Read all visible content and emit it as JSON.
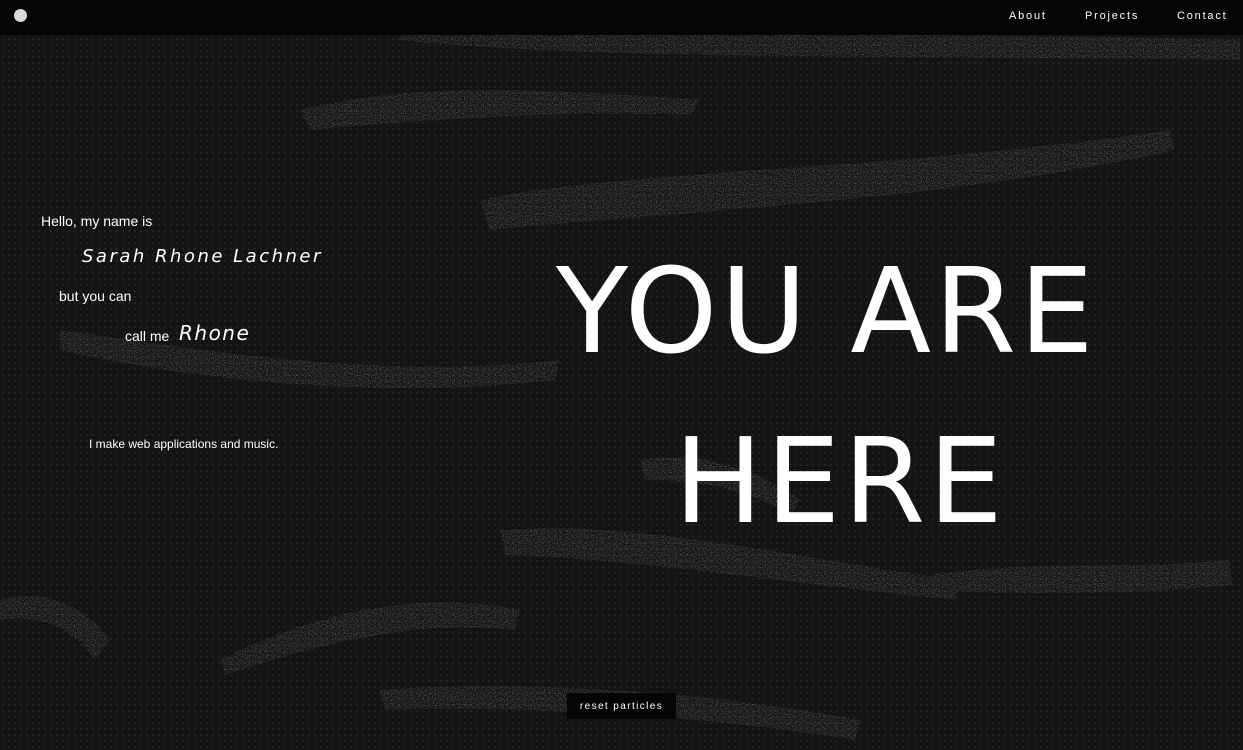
{
  "header": {
    "nav": {
      "about": "About",
      "projects": "Projects",
      "contact": "Contact"
    }
  },
  "intro": {
    "greeting": "Hello, my name is",
    "full_name": "Sarah Rhone Lachner",
    "but": "but you can",
    "call_me": "call me",
    "nickname": "Rhone",
    "tagline": "I make web applications and music."
  },
  "hero": {
    "line1": "YOU ARE",
    "line2": "HERE"
  },
  "controls": {
    "reset_label": "reset particles"
  }
}
